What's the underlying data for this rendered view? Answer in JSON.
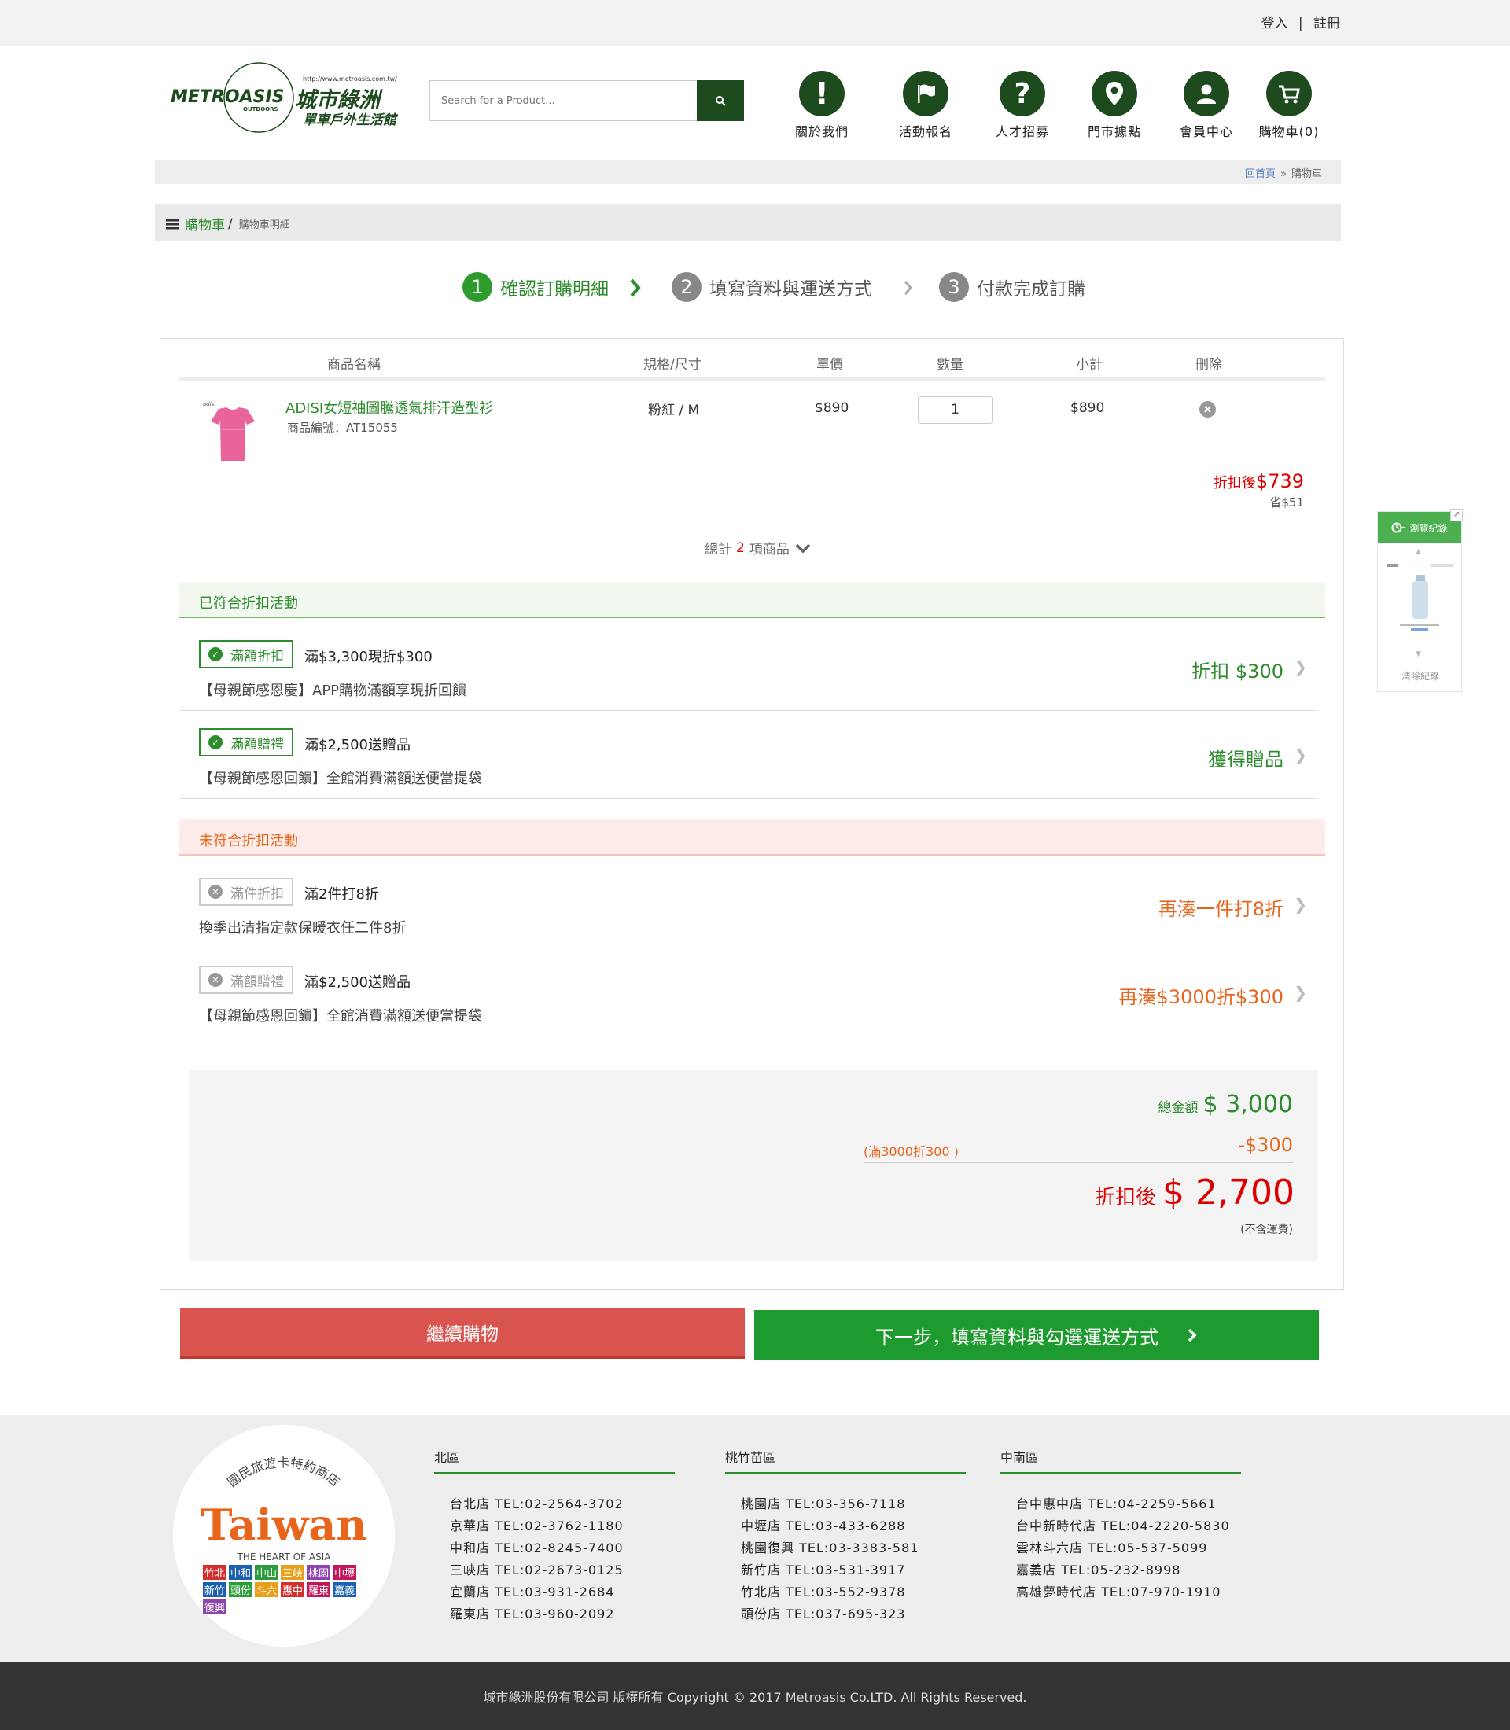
{
  "topbar": {
    "login": "登入",
    "sep": "|",
    "register": "註冊"
  },
  "logo": {
    "brand": "METROASIS",
    "sub": "OUTDOORS",
    "cn": "城市綠洲",
    "url": "http://www.metroasis.com.tw/",
    "tagline": "單車戶外生活館"
  },
  "search": {
    "placeholder": "Search for a Product..."
  },
  "nav": [
    {
      "label": "關於我們",
      "icon": "exclamation-icon"
    },
    {
      "label": "活動報名",
      "icon": "flag-icon"
    },
    {
      "label": "人才招募",
      "icon": "question-icon"
    },
    {
      "label": "門市據點",
      "icon": "map-pin-icon"
    },
    {
      "label": "會員中心",
      "icon": "user-icon"
    },
    {
      "label": "購物車(0)",
      "icon": "cart-icon"
    }
  ],
  "breadcrumb": {
    "home": "回首頁",
    "sep": "»",
    "current": "購物車"
  },
  "page_title": {
    "main": "購物車",
    "slash": "/",
    "sub": "購物車明細"
  },
  "steps": [
    {
      "num": "1",
      "label": "確認訂購明細",
      "active": true
    },
    {
      "num": "2",
      "label": "填寫資料與運送方式",
      "active": false
    },
    {
      "num": "3",
      "label": "付款完成訂購",
      "active": false
    }
  ],
  "table": {
    "headers": [
      "商品名稱",
      "規格/尺寸",
      "單價",
      "數量",
      "小計",
      "刪除"
    ],
    "item": {
      "name": "ADISI女短袖圖騰透氣排汗造型衫",
      "sku_label": "商品編號：AT15055",
      "spec": "粉紅 / M",
      "price": "$890",
      "qty": "1",
      "subtotal": "$890",
      "discount_label": "折扣後",
      "discount_price": "$739",
      "saved": "省$51"
    },
    "total_count": {
      "prefix": "總計",
      "count": "2",
      "suffix": "項商品"
    }
  },
  "qualified": {
    "title": "已符合折扣活動",
    "items": [
      {
        "tag": "滿額折扣",
        "name": "滿$3,300現折$300",
        "desc": "【母親節感恩慶】APP購物滿額享現折回饋",
        "action": "折扣 $300"
      },
      {
        "tag": "滿額贈禮",
        "name": "滿$2,500送贈品",
        "desc": "【母親節感恩回饋】全館消費滿額送便當提袋",
        "action": "獲得贈品"
      }
    ]
  },
  "unqualified": {
    "title": "未符合折扣活動",
    "items": [
      {
        "tag": "滿件折扣",
        "name": "滿2件打8折",
        "desc": "換季出清指定款保暖衣任二件8折",
        "action": "再湊一件打8折"
      },
      {
        "tag": "滿額贈禮",
        "name": "滿$2,500送贈品",
        "desc": "【母親節感恩回饋】全館消費滿額送便當提袋",
        "action": "再湊$3000折$300"
      }
    ]
  },
  "summary": {
    "total_label": "總金額",
    "total": "$ 3,000",
    "promo_note": "(滿3000折300 )",
    "promo_amount": "-$300",
    "final_label": "折扣後",
    "final": "$ 2,700",
    "shipping_note": "(不含運費)"
  },
  "buttons": {
    "continue": "繼續購物",
    "next": "下一步，填寫資料與勾選運送方式"
  },
  "side_widget": {
    "title": "瀏覽紀錄",
    "clear": "清除紀錄"
  },
  "footer": {
    "badge": {
      "arc": "國民旅遊卡特約商店",
      "word": "Taiwan",
      "tag": "THE HEART OF ASIA",
      "stores": [
        "竹北",
        "中和",
        "中山",
        "三峽",
        "桃園",
        "中壢",
        "新竹",
        "頭份",
        "斗六",
        "惠中",
        "羅東",
        "嘉義",
        "復興"
      ]
    },
    "columns": [
      {
        "title": "北區",
        "stores": [
          "台北店  TEL:02-2564-3702",
          "京華店  TEL:02-3762-1180",
          "中和店  TEL:02-8245-7400",
          "三峽店  TEL:02-2673-0125",
          "宜蘭店  TEL:03-931-2684",
          "羅東店  TEL:03-960-2092"
        ]
      },
      {
        "title": "桃竹苗區",
        "stores": [
          "桃園店  TEL:03-356-7118",
          "中壢店  TEL:03-433-6288",
          "桃園復興  TEL:03-3383-581",
          "新竹店  TEL:03-531-3917",
          "竹北店  TEL:03-552-9378",
          "頭份店  TEL:037-695-323"
        ]
      },
      {
        "title": "中南區",
        "stores": [
          "台中惠中店  TEL:04-2259-5661",
          "台中新時代店 TEL:04-2220-5830",
          "雲林斗六店 TEL:05-537-5099",
          "嘉義店 TEL:05-232-8998",
          "高雄夢時代店 TEL:07-970-1910"
        ]
      }
    ],
    "copyright": "城市綠洲股份有限公司 版權所有 Copyright © 2017 Metroasis Co.LTD. All Rights Reserved."
  },
  "colors": {
    "green": "#2d8c2d",
    "dark_green": "#1e4b1e",
    "red": "#e00000",
    "orange": "#e8661c",
    "btn_red": "#d9534f",
    "btn_green": "#1e9b2e"
  }
}
